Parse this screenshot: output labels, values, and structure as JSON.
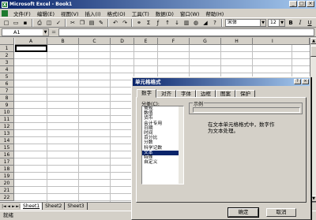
{
  "window": {
    "title": "Microsoft Excel - Book1",
    "logo": "excel-icon"
  },
  "menubar": {
    "items": [
      "文件(F)",
      "编辑(E)",
      "视图(V)",
      "插入(I)",
      "格式(O)",
      "工具(T)",
      "数据(D)",
      "窗口(W)",
      "帮助(H)"
    ]
  },
  "toolbar": {
    "font_name": "宋体",
    "font_size": "12",
    "bold": "B",
    "italic": "I",
    "underline": "U"
  },
  "formula_bar": {
    "name_box": "A1",
    "fx": "="
  },
  "sheet": {
    "columns": [
      "A",
      "B",
      "C",
      "D",
      "E",
      "F",
      "G",
      "H",
      "I"
    ],
    "rows": [
      "1",
      "2",
      "3",
      "4",
      "5",
      "6",
      "7",
      "8",
      "9",
      "10",
      "11",
      "12",
      "13",
      "14",
      "15",
      "16",
      "17",
      "18",
      "19",
      "20",
      "21",
      "22"
    ]
  },
  "sheet_tabs": [
    "Sheet1",
    "Sheet2",
    "Sheet3"
  ],
  "status": "就绪",
  "dialog": {
    "title": "单元格格式",
    "tabs": [
      "数字",
      "对齐",
      "字体",
      "边框",
      "图案",
      "保护"
    ],
    "category_label": "分类(C):",
    "categories": [
      "常规",
      "数值",
      "货币",
      "会计专用",
      "日期",
      "时间",
      "百分比",
      "分数",
      "科学记数",
      "文本",
      "特殊",
      "自定义"
    ],
    "selected_category": "文本",
    "sample_label": "示例",
    "description": "在文本单元格格式中，数字作为文本处理。",
    "ok": "确定",
    "cancel": "取消"
  }
}
